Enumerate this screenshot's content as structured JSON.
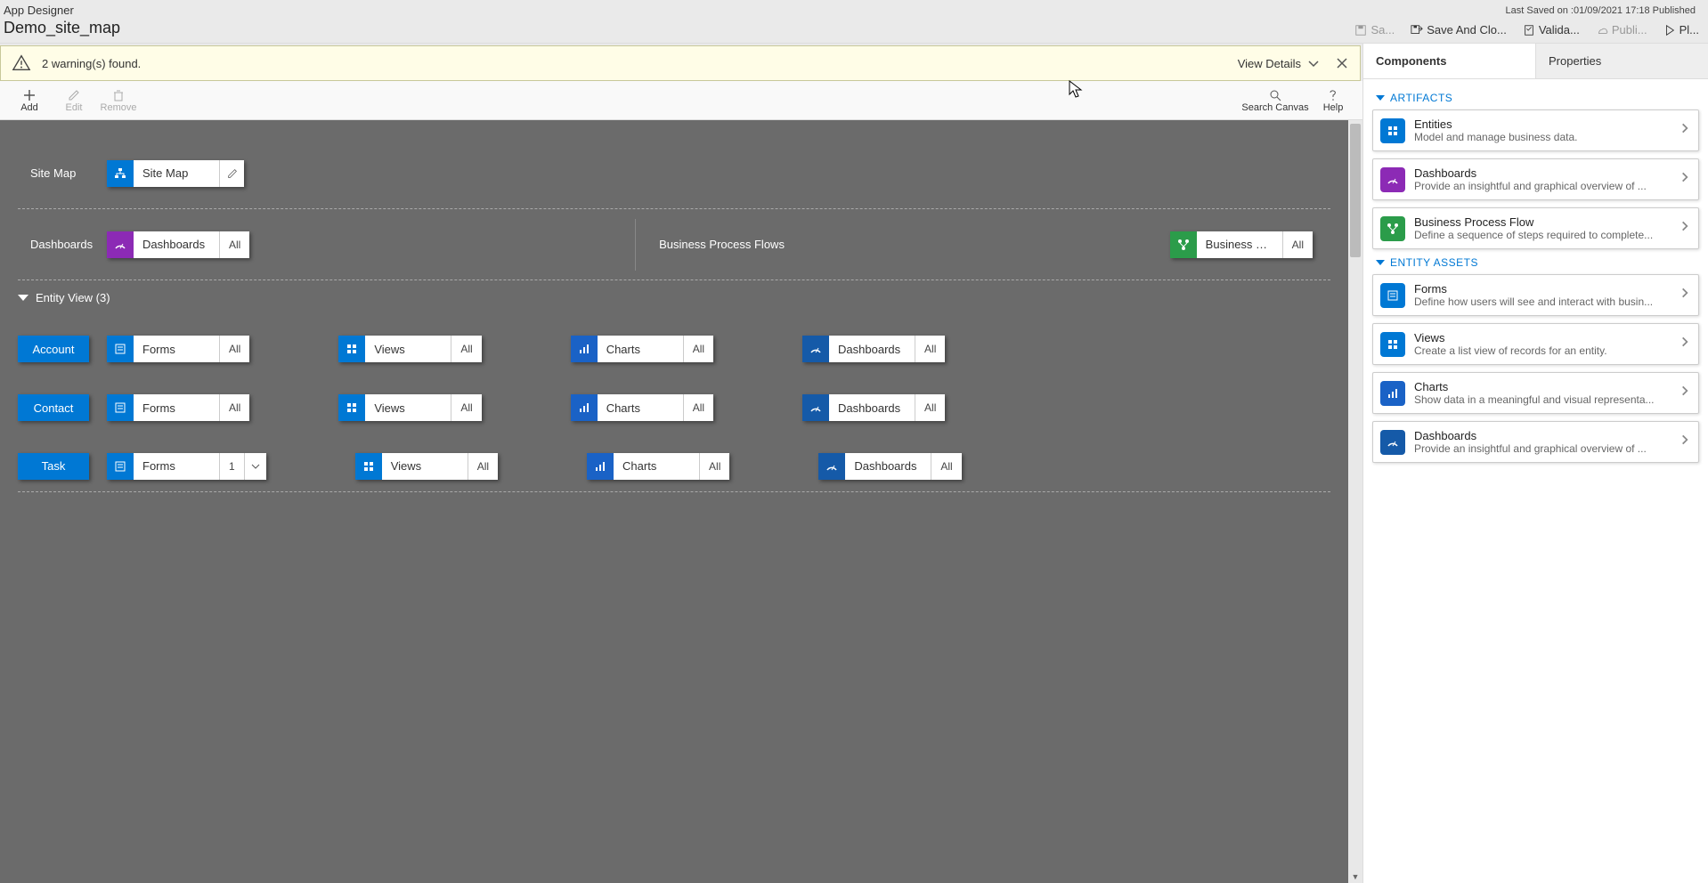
{
  "header": {
    "app_title": "App Designer",
    "app_name": "Demo_site_map",
    "last_saved": "Last Saved on :01/09/2021 17:18 Published",
    "actions": {
      "save": "Sa...",
      "save_and_close": "Save And Clo...",
      "validate": "Valida...",
      "publish": "Publi...",
      "play": "Pl..."
    }
  },
  "warning": {
    "text": "2 warning(s) found.",
    "view_details": "View Details"
  },
  "toolbar": {
    "add": "Add",
    "edit": "Edit",
    "remove": "Remove",
    "search_canvas": "Search Canvas",
    "help": "Help"
  },
  "canvas": {
    "sitemap_row_label": "Site Map",
    "sitemap_tile_label": "Site Map",
    "dashboards_row_label": "Dashboards",
    "dashboards_tile_label": "Dashboards",
    "dashboards_badge": "All",
    "bpf_row_label": "Business Process Flows",
    "bpf_tile_label": "Business Proces...",
    "bpf_badge": "All",
    "entity_view_header": "Entity View (3)",
    "entities": [
      {
        "name": "Account",
        "forms_badge": "All"
      },
      {
        "name": "Contact",
        "forms_badge": "All"
      },
      {
        "name": "Task",
        "forms_badge": "1"
      }
    ],
    "asset_labels": {
      "forms": "Forms",
      "views": "Views",
      "charts": "Charts",
      "dashboards": "Dashboards"
    },
    "all_text": "All"
  },
  "right_panel": {
    "tabs": {
      "components": "Components",
      "properties": "Properties"
    },
    "sections": {
      "artifacts": "ARTIFACTS",
      "entity_assets": "ENTITY ASSETS"
    },
    "artifacts": [
      {
        "title": "Entities",
        "desc": "Model and manage business data.",
        "color": "ic-blue",
        "icon": "grid"
      },
      {
        "title": "Dashboards",
        "desc": "Provide an insightful and graphical overview of ...",
        "color": "ic-purple",
        "icon": "gauge"
      },
      {
        "title": "Business Process Flow",
        "desc": "Define a sequence of steps required to complete...",
        "color": "ic-green",
        "icon": "flow"
      }
    ],
    "entity_assets": [
      {
        "title": "Forms",
        "desc": "Define how users will see and interact with busin...",
        "color": "ic-blue",
        "icon": "form"
      },
      {
        "title": "Views",
        "desc": "Create a list view of records for an entity.",
        "color": "ic-blue",
        "icon": "grid"
      },
      {
        "title": "Charts",
        "desc": "Show data in a meaningful and visual representa...",
        "color": "ic-navy",
        "icon": "chart"
      },
      {
        "title": "Dashboards",
        "desc": "Provide an insightful and graphical overview of ...",
        "color": "ic-darkblue",
        "icon": "gauge"
      }
    ]
  }
}
